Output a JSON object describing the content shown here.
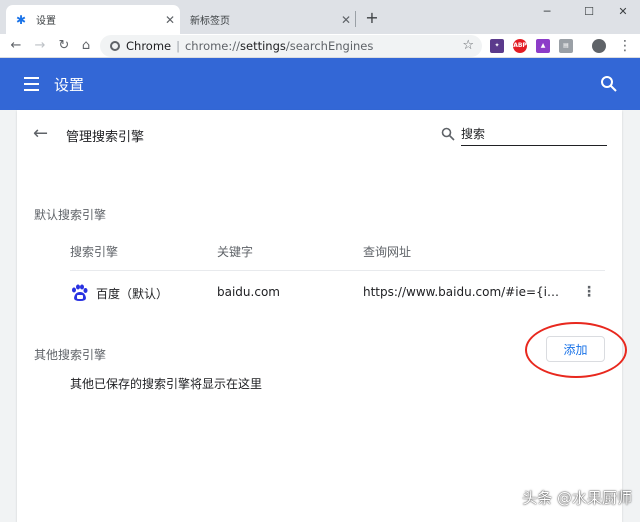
{
  "tabs": [
    {
      "title": "设置",
      "active": true
    },
    {
      "title": "新标签页",
      "active": false
    }
  ],
  "window_controls": {
    "minimize": "─",
    "maximize": "☐",
    "close": "✕"
  },
  "toolbar": {
    "back": "←",
    "forward": "→",
    "reload": "↻",
    "home": "⌂",
    "omnibox_label": "Chrome",
    "url_prefix": "chrome://",
    "url_host": "settings",
    "url_path": "/searchEngines",
    "bookmark_star": "☆",
    "menu": "⋮",
    "extensions": [
      {
        "name": "extension-1",
        "color": "#5b3a8c"
      },
      {
        "name": "adblock-plus",
        "label": "ABP",
        "color": "#e31d25"
      },
      {
        "name": "extension-3",
        "color": "#8c3cc8"
      },
      {
        "name": "extension-4",
        "color": "#9aa0a6"
      }
    ]
  },
  "header": {
    "title": "设置",
    "accent": "#3367d6"
  },
  "page": {
    "back": "←",
    "title": "管理搜索引擎",
    "search_placeholder": "搜索"
  },
  "default_section": {
    "label": "默认搜索引擎",
    "columns": [
      "搜索引擎",
      "关键字",
      "查询网址"
    ],
    "engines": [
      {
        "name": "百度（默认）",
        "keyword": "baidu.com",
        "url": "https://www.baidu.com/#ie={inputEncoding}&wd=%s",
        "menu": "⋮"
      }
    ]
  },
  "other_section": {
    "label": "其他搜索引擎",
    "add_label": "添加",
    "empty_message": "其他已保存的搜索引擎将显示在这里"
  },
  "watermark": "头条 @水果厨师"
}
